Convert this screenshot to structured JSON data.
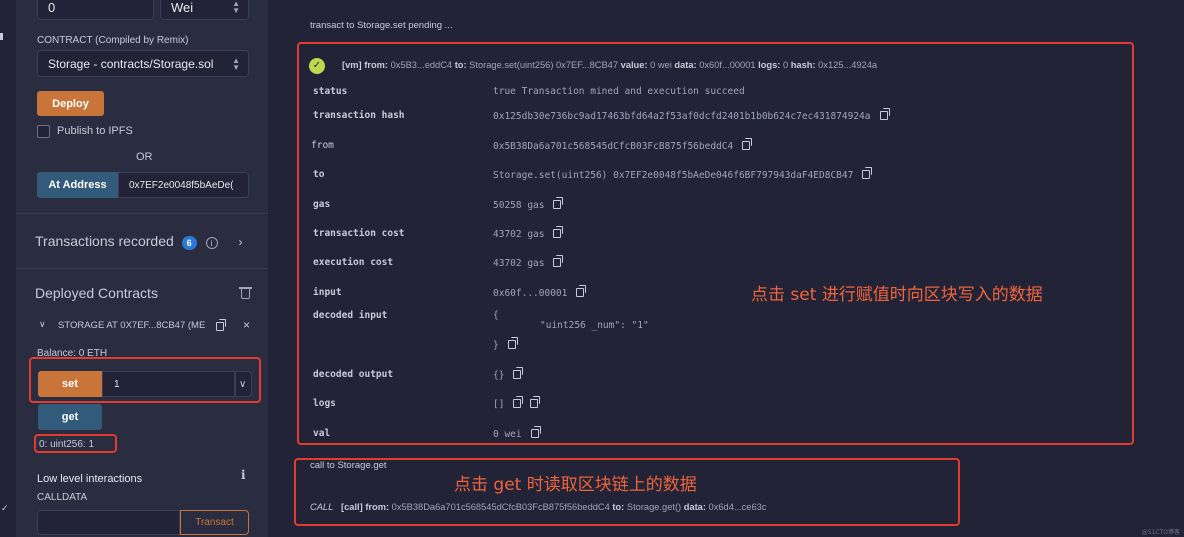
{
  "sidebar": {
    "value_input": "0",
    "unit_select": "Wei",
    "contract_label": "CONTRACT (Compiled by Remix)",
    "contract_select": "Storage - contracts/Storage.sol",
    "deploy_label": "Deploy",
    "publish_label": "Publish to IPFS",
    "or_label": "OR",
    "at_address_label": "At Address",
    "at_address_value": "0x7EF2e0048f5bAeDe(",
    "transactions_label": "Transactions recorded",
    "transactions_count": "6",
    "deployed_title": "Deployed Contracts",
    "contract_instance": "STORAGE AT 0X7EF...8CB47 (ME",
    "balance": "Balance: 0 ETH",
    "set_label": "set",
    "set_value": "1",
    "get_label": "get",
    "get_result": "0: uint256: 1",
    "low_level_title": "Low level interactions",
    "calldata_label": "CALLDATA",
    "transact_label": "Transact"
  },
  "terminal": {
    "pending_line": "transact to Storage.set pending ...",
    "tx_summary": {
      "prefix": "[vm]",
      "from_k": "from:",
      "from_v": "0x5B3...eddC4",
      "to_k": "to:",
      "to_v": "Storage.set(uint256) 0x7EF...8CB47",
      "value_k": "value:",
      "value_v": "0 wei",
      "data_k": "data:",
      "data_v": "0x60f...00001",
      "logs_k": "logs:",
      "logs_v": "0",
      "hash_k": "hash:",
      "hash_v": "0x125...4924a"
    },
    "rows": {
      "status_k": "status",
      "status_v": "true Transaction mined and execution succeed",
      "hash_k": "transaction hash",
      "hash_v": "0x125db30e736bc9ad17463bfd64a2f53af0dcfd2401b1b0b624c7ec431874924a",
      "from_k": "from",
      "from_v": "0x5B38Da6a701c568545dCfcB03FcB875f56beddC4",
      "to_k": "to",
      "to_v": "Storage.set(uint256) 0x7EF2e0048f5bAeDe046f6BF797943daF4ED8CB47",
      "gas_k": "gas",
      "gas_v": "50258 gas",
      "txcost_k": "transaction cost",
      "txcost_v": "43702 gas",
      "excost_k": "execution cost",
      "excost_v": "43702 gas",
      "input_k": "input",
      "input_v": "0x60f...00001",
      "decoded_input_k": "decoded input",
      "decoded_input_open": "{",
      "decoded_input_body": "\"uint256 _num\": \"1\"",
      "decoded_input_close": "}",
      "decoded_output_k": "decoded output",
      "decoded_output_v": "{}",
      "logs_k": "logs",
      "logs_v": "[]",
      "val_k": "val",
      "val_v": "0 wei"
    },
    "call_line": "call to Storage.get",
    "call_summary": {
      "prefix": "CALL",
      "tag": "[call]",
      "from_k": "from:",
      "from_v": "0x5B38Da6a701c568545dCfcB03FcB875f56beddC4",
      "to_k": "to:",
      "to_v": "Storage.get()",
      "data_k": "data:",
      "data_v": "0x6d4...ce63c"
    }
  },
  "annotations": {
    "set_note": "点击 set 进行赋值时向区块写入的数据",
    "get_note": "点击 get 时读取区块链上的数据"
  },
  "watermark": "@51CTO博客",
  "colors": {
    "accent_orange": "#c97539",
    "accent_blue": "#325a7a",
    "annotation_red": "#e23b32",
    "success_green": "#bfd94c"
  }
}
